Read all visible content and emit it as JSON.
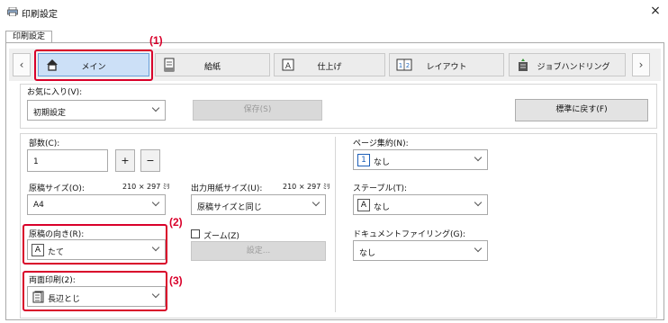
{
  "window": {
    "title": "印刷設定",
    "close_label": "×"
  },
  "outer_tab": "印刷設定",
  "tabs": [
    {
      "id": "main",
      "label": "メイン"
    },
    {
      "id": "paper",
      "label": "給紙"
    },
    {
      "id": "finishing",
      "label": "仕上げ"
    },
    {
      "id": "layout",
      "label": "レイアウト"
    },
    {
      "id": "job",
      "label": "ジョブハンドリング"
    }
  ],
  "nav": {
    "prev": "‹",
    "next": "›"
  },
  "annotations": {
    "n1": "(1)",
    "n2": "(2)",
    "n3": "(3)"
  },
  "favorites": {
    "label": "お気に入り(V):",
    "value": "初期設定",
    "save_label": "保存(S)",
    "default_label": "標準に戻す(F)"
  },
  "copies": {
    "label": "部数(C):",
    "value": "1",
    "plus": "+",
    "minus": "−"
  },
  "original_size": {
    "label": "原稿サイズ(O):",
    "dims": "210 × 297 ﾐﾘ",
    "value": "A4"
  },
  "output_size": {
    "label": "出力用紙サイズ(U):",
    "dims": "210 × 297 ﾐﾘ",
    "value": "原稿サイズと同じ"
  },
  "orientation": {
    "label": "原稿の向き(R):",
    "value": "たて",
    "icon_char": "A"
  },
  "zoom": {
    "label": "ズーム(Z)",
    "settings_label": "設定..."
  },
  "duplex": {
    "label": "両面印刷(2):",
    "value": "長辺とじ"
  },
  "nup": {
    "label": "ページ集約(N):",
    "value": "なし",
    "icon_char": "1"
  },
  "staple": {
    "label": "ステープル(T):",
    "value": "なし",
    "icon_char": "A"
  },
  "filing": {
    "label": "ドキュメントファイリング(G):",
    "value": "なし"
  },
  "colors": {
    "accent": "#d9002a",
    "selected_tab": "#cce0f7"
  }
}
